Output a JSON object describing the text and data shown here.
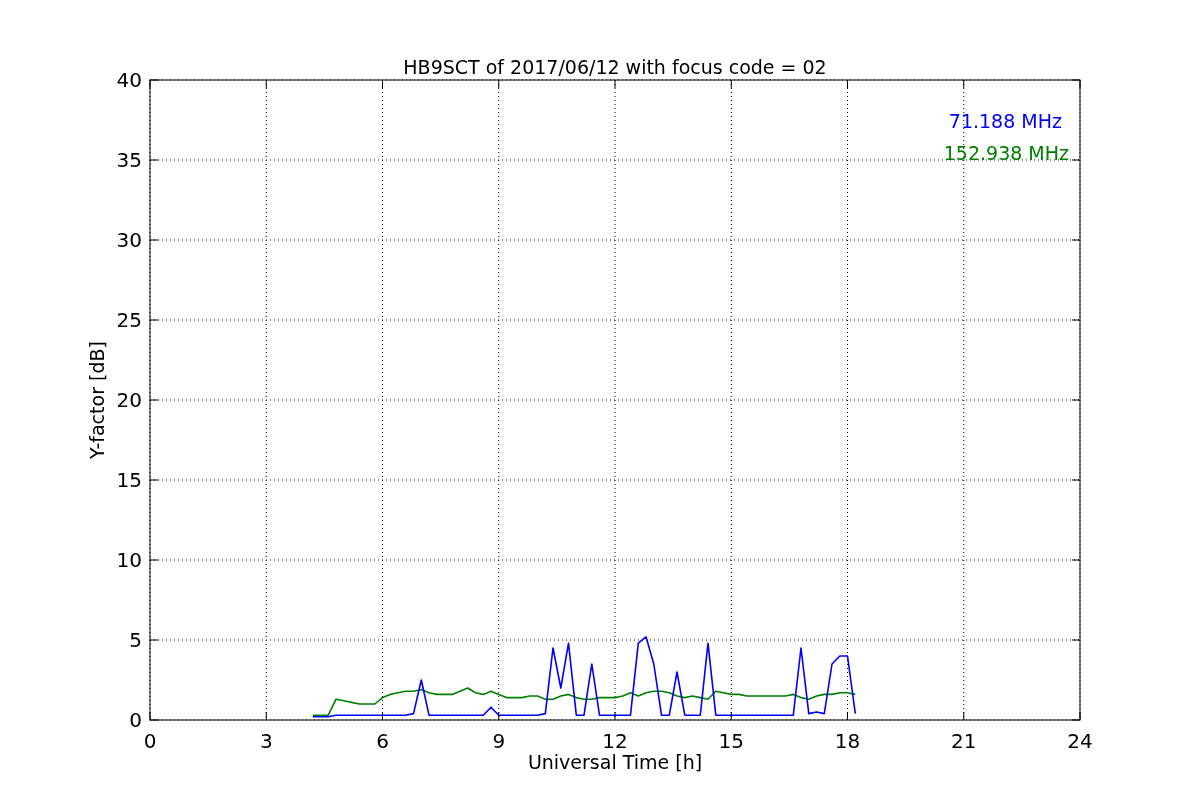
{
  "figure": {
    "chart_data": {
      "type": "line",
      "grid": true,
      "title": "HB9SCT of 2017/06/12 with focus code = 02",
      "xlabel": "Universal Time [h]",
      "ylabel": "Y-factor [dB]",
      "xlim": [
        0,
        24
      ],
      "ylim": [
        0,
        40
      ],
      "xticks": [
        0,
        3,
        6,
        9,
        12,
        15,
        18,
        21,
        24
      ],
      "yticks": [
        0,
        5,
        10,
        15,
        20,
        25,
        30,
        35,
        40
      ],
      "x": [
        4.2,
        4.4,
        4.6,
        4.8,
        5.0,
        5.2,
        5.4,
        5.6,
        5.8,
        6.0,
        6.2,
        6.4,
        6.6,
        6.8,
        7.0,
        7.2,
        7.4,
        7.6,
        7.8,
        8.0,
        8.2,
        8.4,
        8.6,
        8.8,
        9.0,
        9.2,
        9.4,
        9.6,
        9.8,
        10.0,
        10.2,
        10.4,
        10.6,
        10.8,
        11.0,
        11.2,
        11.4,
        11.6,
        11.8,
        12.0,
        12.2,
        12.4,
        12.6,
        12.8,
        13.0,
        13.2,
        13.4,
        13.6,
        13.8,
        14.0,
        14.2,
        14.4,
        14.6,
        14.8,
        15.0,
        15.2,
        15.4,
        15.6,
        15.8,
        16.0,
        16.2,
        16.4,
        16.6,
        16.8,
        17.0,
        17.2,
        17.4,
        17.6,
        17.8,
        18.0,
        18.2
      ],
      "series": [
        {
          "name": "71.188 MHz",
          "color": "#0000ff",
          "values": [
            0.2,
            0.2,
            0.2,
            0.3,
            0.3,
            0.3,
            0.3,
            0.3,
            0.3,
            0.3,
            0.3,
            0.3,
            0.3,
            0.4,
            2.5,
            0.3,
            0.3,
            0.3,
            0.3,
            0.3,
            0.3,
            0.3,
            0.3,
            0.8,
            0.3,
            0.3,
            0.3,
            0.3,
            0.3,
            0.3,
            0.4,
            4.5,
            2.0,
            4.8,
            0.3,
            0.3,
            3.5,
            0.3,
            0.3,
            0.3,
            0.3,
            0.3,
            4.8,
            5.2,
            3.5,
            0.3,
            0.3,
            3.0,
            0.3,
            0.3,
            0.3,
            4.8,
            0.3,
            0.3,
            0.3,
            0.3,
            0.3,
            0.3,
            0.3,
            0.3,
            0.3,
            0.3,
            0.3,
            4.5,
            0.4,
            0.5,
            0.4,
            3.5,
            4.0,
            4.0,
            0.4
          ]
        },
        {
          "name": "152.938 MHz",
          "color": "#008000",
          "values": [
            0.3,
            0.3,
            0.3,
            1.3,
            1.2,
            1.1,
            1.0,
            1.0,
            1.0,
            1.4,
            1.6,
            1.7,
            1.8,
            1.8,
            1.9,
            1.7,
            1.6,
            1.6,
            1.6,
            1.8,
            2.0,
            1.7,
            1.6,
            1.8,
            1.6,
            1.4,
            1.4,
            1.4,
            1.5,
            1.5,
            1.3,
            1.3,
            1.5,
            1.6,
            1.4,
            1.3,
            1.3,
            1.4,
            1.4,
            1.4,
            1.5,
            1.7,
            1.5,
            1.7,
            1.8,
            1.8,
            1.7,
            1.5,
            1.4,
            1.5,
            1.4,
            1.3,
            1.8,
            1.7,
            1.6,
            1.6,
            1.5,
            1.5,
            1.5,
            1.5,
            1.5,
            1.5,
            1.6,
            1.4,
            1.3,
            1.5,
            1.6,
            1.6,
            1.7,
            1.7,
            1.6
          ]
        }
      ]
    }
  }
}
